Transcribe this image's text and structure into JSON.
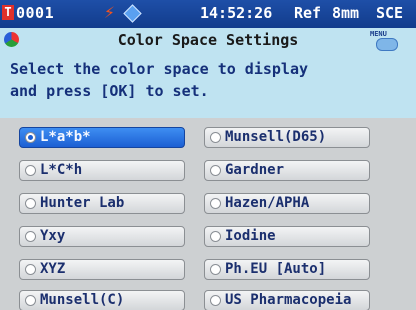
{
  "status_bar": {
    "device_id": "0001",
    "time": "14:52:26",
    "mode": "Ref",
    "aperture": "8mm",
    "specular": "SCE"
  },
  "title_bar": {
    "title": "Color Space Settings",
    "menu_label": "MENU"
  },
  "instruction": {
    "line1": "Select the color space to display",
    "line2": "and press [OK] to set."
  },
  "options": [
    {
      "label": "L*a*b*",
      "selected": true
    },
    {
      "label": "Munsell(D65)",
      "selected": false
    },
    {
      "label": "L*C*h",
      "selected": false
    },
    {
      "label": "Gardner",
      "selected": false
    },
    {
      "label": "Hunter Lab",
      "selected": false
    },
    {
      "label": "Hazen/APHA",
      "selected": false
    },
    {
      "label": "Yxy",
      "selected": false
    },
    {
      "label": "Iodine",
      "selected": false
    },
    {
      "label": "XYZ",
      "selected": false
    },
    {
      "label": "Ph.EU [Auto]",
      "selected": false
    },
    {
      "label": "Munsell(C)",
      "selected": false
    },
    {
      "label": "US Pharmacopeia",
      "selected": false
    }
  ],
  "colors": {
    "status_bar": "#1e4fa8",
    "title_bar": "#bfe3f1",
    "selected_option": "#1c5fd3",
    "text": "#1b2f6e"
  }
}
